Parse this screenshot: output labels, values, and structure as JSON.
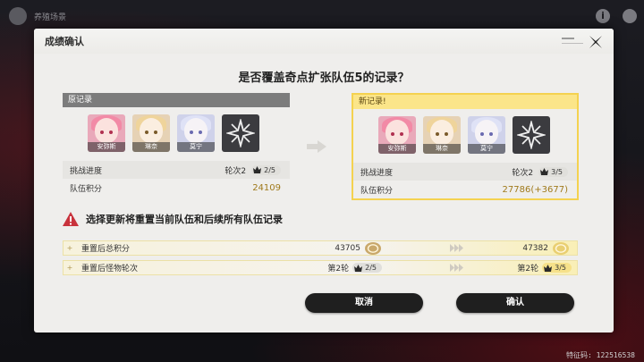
{
  "background": {
    "top_title": "养殖场景",
    "help_icon": "i",
    "uid": "特征码: 122516538"
  },
  "dialog": {
    "title": "成绩确认",
    "question": "是否覆盖奇点扩张队伍5的记录？",
    "old_record": {
      "header": "原记录",
      "members": [
        "安弥斯",
        "琳奈",
        "莫宁",
        ""
      ],
      "progress_label": "挑战进度",
      "round": "轮次2",
      "round_badge": "2/5",
      "score_label": "队伍积分",
      "score": "24109"
    },
    "new_record": {
      "header": "新记录!",
      "members": [
        "安弥斯",
        "琳奈",
        "莫宁",
        ""
      ],
      "progress_label": "挑战进度",
      "round": "轮次2",
      "round_badge": "3/5",
      "score_label": "队伍积分",
      "score": "27786(+3677)"
    },
    "warning": "选择更新将重置当前队伍和后续所有队伍记录",
    "reset_rows": [
      {
        "plus": "+",
        "label": "重置后总积分",
        "old_value": "43705",
        "new_value": "47382"
      },
      {
        "plus": "+",
        "label": "重置后怪物轮次",
        "old_round": "第2轮",
        "old_badge": "2/5",
        "new_round": "第2轮",
        "new_badge": "3/5"
      }
    ],
    "cancel_label": "取消",
    "confirm_label": "确认"
  },
  "colors": {
    "accent_gold": "#f4d250",
    "button_dark": "#1f1f1f",
    "warning_red": "#c8323c"
  },
  "icons": [
    "close-icon",
    "crown-icon",
    "coin-icon",
    "warning-icon",
    "arrow-right-icon"
  ]
}
